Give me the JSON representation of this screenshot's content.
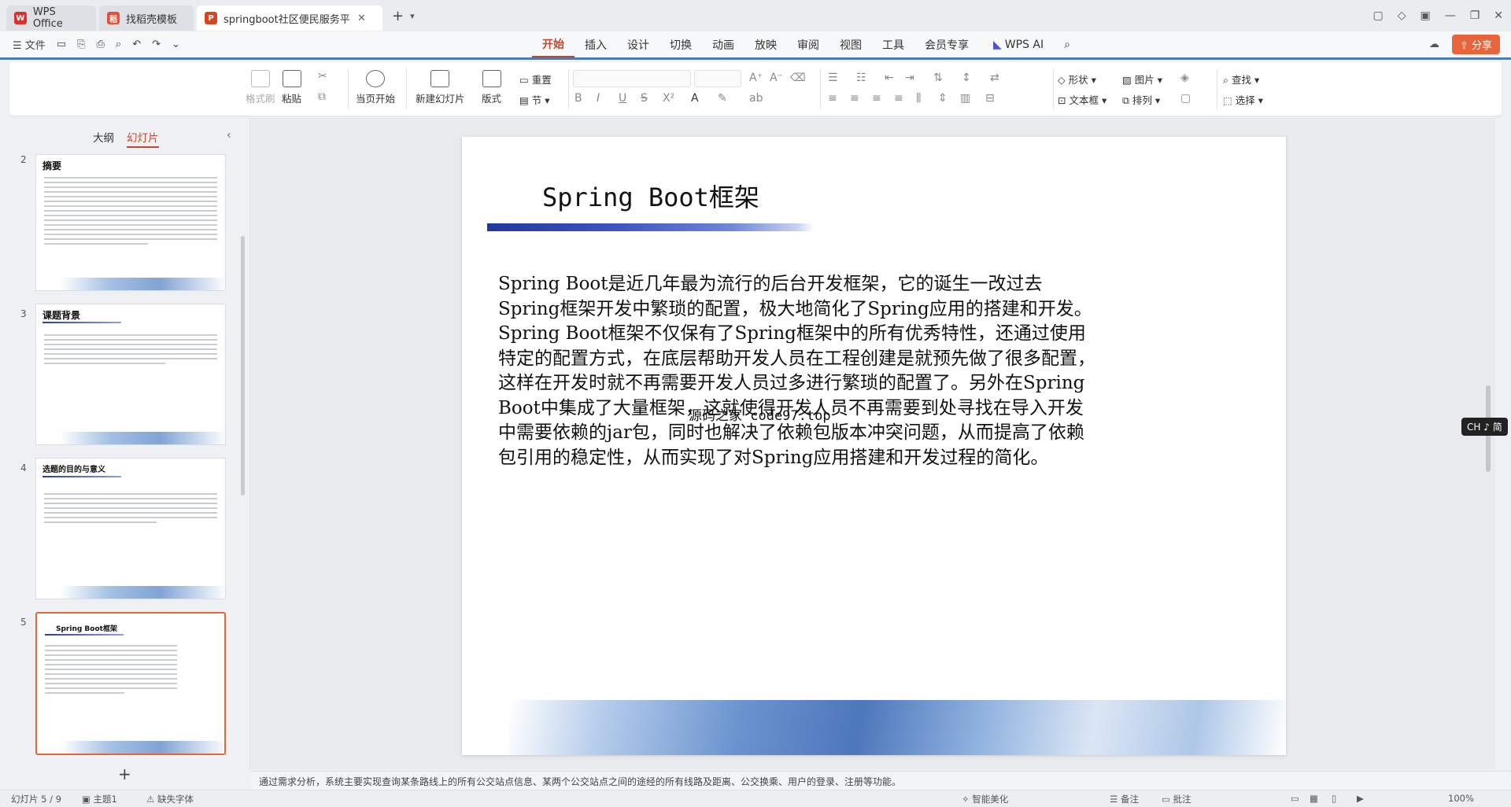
{
  "tabs": [
    {
      "label": "WPS Office",
      "color": "#d8322c",
      "icon": "wps-logo-icon"
    },
    {
      "label": "找稻壳模板",
      "color": "#e2523a",
      "icon": "docer-icon"
    },
    {
      "label": "springboot社区便民服务平台",
      "color": "#d24726",
      "icon": "ppt-icon",
      "active": true
    }
  ],
  "menu": {
    "file_label": "文件",
    "tabs": [
      "开始",
      "插入",
      "设计",
      "切换",
      "动画",
      "放映",
      "审阅",
      "视图",
      "工具",
      "会员专享"
    ],
    "active_tab": "开始",
    "wps_ai": "WPS AI",
    "share": "分享"
  },
  "ribbon": {
    "format_painter": "格式刷",
    "paste": "粘贴",
    "start_show": "当页开始",
    "new_slide": "新建幻灯片",
    "layout": "版式",
    "reset": "重置",
    "section": "节",
    "shape": "形状",
    "image": "图片",
    "textbox": "文本框",
    "arrange": "排列",
    "find": "查找",
    "select": "选择"
  },
  "left_panel": {
    "tab_outline": "大纲",
    "tab_slides": "幻灯片",
    "thumbnails": [
      {
        "num": "2",
        "title": "摘要"
      },
      {
        "num": "3",
        "title": "课题背景"
      },
      {
        "num": "4",
        "title": "选题的目的与意义"
      },
      {
        "num": "5",
        "title": "Spring Boot框架",
        "selected": true
      }
    ]
  },
  "slide": {
    "title": "Spring Boot框架",
    "body": "Spring Boot是近几年最为流行的后台开发框架，它的诞生一改过去Spring框架开发中繁琐的配置，极大地简化了Spring应用的搭建和开发。Spring Boot框架不仅保有了Spring框架中的所有优秀特性，还通过使用特定的配置方式，在底层帮助开发人员在工程创建是就预先做了很多配置，这样在开发时就不再需要开发人员过多进行繁琐的配置了。另外在Spring Boot中集成了大量框架，这就使得开发人员不再需要到处寻找在导入开发中需要依赖的jar包，同时也解决了依赖包版本冲突问题，从而提高了依赖包引用的稳定性，从而实现了对Spring应用搭建和开发过程的简化。",
    "watermark": "源码之家 code97.top"
  },
  "ime": "CH ♪ 简",
  "notes": "通过需求分析，系统主要实现查询某条路线上的所有公交站点信息、某两个公交站点之间的途经的所有线路及距离、公交换乘、用户的登录、注册等功能。",
  "status": {
    "slide_info": "幻灯片 5 / 9",
    "theme": "主题1",
    "font_missing": "缺失字体",
    "smart_beautify": "智能美化",
    "notes": "备注",
    "comments": "批注",
    "zoom": "100%"
  }
}
